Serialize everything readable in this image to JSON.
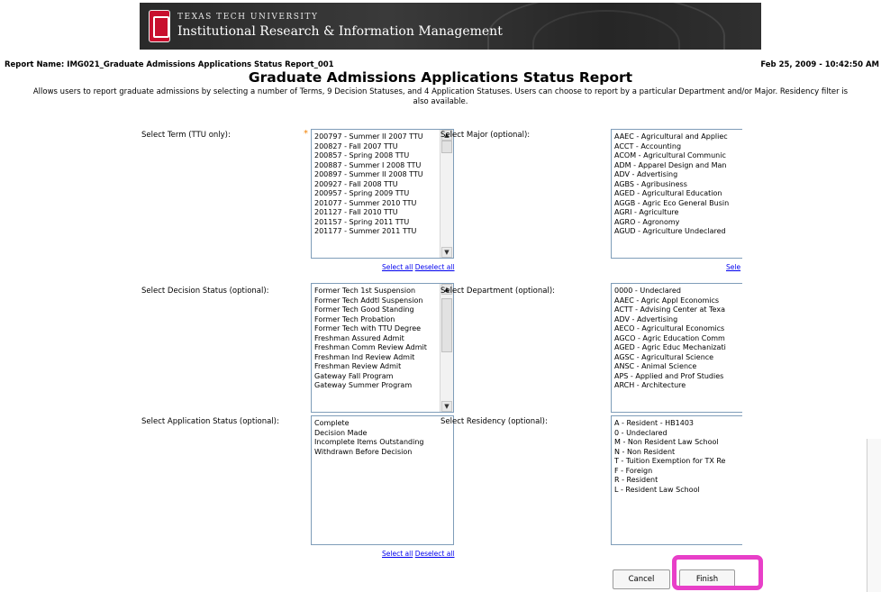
{
  "header": {
    "logo_icon": "ttu-double-t-logo",
    "university": "TEXAS TECH UNIVERSITY",
    "department": "Institutional Research & Information Management",
    "report_name": "Report Name: IMG021_Graduate Admissions Applications Status Report_001",
    "date": "Feb 25, 2009 - 10:42:50 AM"
  },
  "report": {
    "title": "Graduate Admissions Applications Status Report",
    "description_line1": "Allows users to report graduate admissions by selecting a number of Terms, 9 Decision Statuses, and 4 Application Statuses.  Users can choose to report by a particular Department and/or Major.  Residency filter is",
    "description_line2": "also available."
  },
  "required_marker": "*",
  "term": {
    "label": "Select Term (TTU only):",
    "options": [
      "200797 - Summer II 2007 TTU",
      "200827 - Fall 2007 TTU",
      "200857 - Spring 2008 TTU",
      "200887 - Summer I 2008 TTU",
      "200897 - Summer II 2008 TTU",
      "200927 - Fall 2008 TTU",
      "200957 - Spring 2009 TTU",
      "201077 - Summer 2010 TTU",
      "201127 - Fall 2010 TTU",
      "201157 - Spring 2011 TTU",
      "201177 - Summer 2011 TTU"
    ],
    "select_all": "Select all",
    "deselect_all": "Deselect all"
  },
  "major": {
    "label": "Select Major (optional):",
    "options": [
      "AAEC - Agricultural and Appliec",
      "ACCT - Accounting",
      "ACOM - Agricultural Communic",
      "ADM - Apparel Design and Man",
      "ADV - Advertising",
      "AGBS - Agribusiness",
      "AGED - Agricultural Education",
      "AGGB - Agric Eco General Busin",
      "AGRI - Agriculture",
      "AGRO - Agronomy",
      "AGUD - Agriculture Undeclared"
    ],
    "select_link": "Sele"
  },
  "decision": {
    "label": "Select Decision Status (optional):",
    "options": [
      "Former Tech 1st Suspension",
      "Former Tech Addtl Suspension",
      "Former Tech Good Standing",
      "Former Tech Probation",
      "Former Tech with TTU Degree",
      "Freshman Assured Admit",
      "Freshman Comm Review Admit",
      "Freshman Ind Review Admit",
      "Freshman Review Admit",
      "Gateway Fall Program",
      "Gateway Summer Program"
    ]
  },
  "department": {
    "label": "Select Department (optional):",
    "options": [
      "0000 - Undeclared",
      "AAEC - Agric  Appl Economics",
      "ACTT - Advising Center at Texa",
      "ADV - Advertising",
      "AECO - Agricultural Economics",
      "AGCO - Agric Education Comm",
      "AGED - Agric Educ  Mechanizati",
      "AGSC - Agricultural Science",
      "ANSC - Animal Science",
      "APS - Applied and Prof Studies",
      "ARCH - Architecture"
    ]
  },
  "application": {
    "label": "Select Application Status (optional):",
    "options": [
      "Complete",
      "Decision Made",
      "Incomplete Items Outstanding",
      "Withdrawn Before Decision"
    ],
    "select_all": "Select all",
    "deselect_all": "Deselect all"
  },
  "residency": {
    "label": "Select Residency (optional):",
    "options": [
      "A - Resident - HB1403",
      "0 - Undeclared",
      "M - Non Resident Law School",
      "N - Non Resident",
      "T - Tuition Exemption for TX Re",
      "F - Foreign",
      "R - Resident",
      "L - Resident Law School"
    ]
  },
  "buttons": {
    "cancel": "Cancel",
    "finish": "Finish"
  },
  "colors": {
    "highlight": "#e83fc8",
    "link": "#0000ee",
    "required": "#f08000"
  }
}
